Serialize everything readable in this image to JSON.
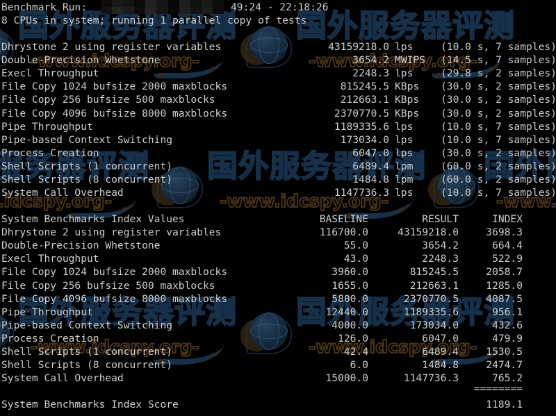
{
  "terminal": {
    "header_line1_label": "Benchmark Run:",
    "header_line1_redacted": "[redacted]",
    "header_line1_time": "49:24 - 22:18:26",
    "header_line2": "8 CPUs in system; running 1 parallel copy of tests",
    "background_color": "#000000",
    "text_color": "#cfcfcf"
  },
  "watermark": {
    "cjk_text": "国外服务器评测",
    "url_text": "-www.idcspy.org-",
    "cjk_color": "#16304a",
    "url_color": "#4a3415"
  },
  "run_results": {
    "rows": [
      {
        "name": "Dhrystone 2 using register variables",
        "value": "43159218.0",
        "unit": "lps",
        "timing": "(10.0 s, 7 samples)"
      },
      {
        "name": "Double-Precision Whetstone",
        "value": "3654.2",
        "unit": "MWIPS",
        "timing": "(14.5 s, 7 samples)"
      },
      {
        "name": "Execl Throughput",
        "value": "2248.3",
        "unit": "lps",
        "timing": "(29.8 s, 2 samples)"
      },
      {
        "name": "File Copy 1024 bufsize 2000 maxblocks",
        "value": "815245.5",
        "unit": "KBps",
        "timing": "(30.0 s, 2 samples)"
      },
      {
        "name": "File Copy 256 bufsize 500 maxblocks",
        "value": "212663.1",
        "unit": "KBps",
        "timing": "(30.0 s, 2 samples)"
      },
      {
        "name": "File Copy 4096 bufsize 8000 maxblocks",
        "value": "2370770.5",
        "unit": "KBps",
        "timing": "(30.0 s, 2 samples)"
      },
      {
        "name": "Pipe Throughput",
        "value": "1189335.6",
        "unit": "lps",
        "timing": "(10.0 s, 7 samples)"
      },
      {
        "name": "Pipe-based Context Switching",
        "value": "173034.0",
        "unit": "lps",
        "timing": "(10.0 s, 7 samples)"
      },
      {
        "name": "Process Creation",
        "value": "6047.0",
        "unit": "lps",
        "timing": "(30.0 s, 2 samples)"
      },
      {
        "name": "Shell Scripts (1 concurrent)",
        "value": "6489.4",
        "unit": "lpm",
        "timing": "(60.0 s, 2 samples)"
      },
      {
        "name": "Shell Scripts (8 concurrent)",
        "value": "1484.8",
        "unit": "lpm",
        "timing": "(60.0 s, 2 samples)"
      },
      {
        "name": "System Call Overhead",
        "value": "1147736.3",
        "unit": "lps",
        "timing": "(10.0 s, 7 samples)"
      }
    ]
  },
  "index_table": {
    "title": "System Benchmarks Index Values",
    "header_baseline": "BASELINE",
    "header_result": "RESULT",
    "header_index": "INDEX",
    "rows": [
      {
        "name": "Dhrystone 2 using register variables",
        "baseline": "116700.0",
        "result": "43159218.0",
        "index": "3698.3"
      },
      {
        "name": "Double-Precision Whetstone",
        "baseline": "55.0",
        "result": "3654.2",
        "index": "664.4"
      },
      {
        "name": "Execl Throughput",
        "baseline": "43.0",
        "result": "2248.3",
        "index": "522.9"
      },
      {
        "name": "File Copy 1024 bufsize 2000 maxblocks",
        "baseline": "3960.0",
        "result": "815245.5",
        "index": "2058.7"
      },
      {
        "name": "File Copy 256 bufsize 500 maxblocks",
        "baseline": "1655.0",
        "result": "212663.1",
        "index": "1285.0"
      },
      {
        "name": "File Copy 4096 bufsize 8000 maxblocks",
        "baseline": "5800.0",
        "result": "2370770.5",
        "index": "4087.5"
      },
      {
        "name": "Pipe Throughput",
        "baseline": "12440.0",
        "result": "1189335.6",
        "index": "956.1"
      },
      {
        "name": "Pipe-based Context Switching",
        "baseline": "4000.0",
        "result": "173034.0",
        "index": "432.6"
      },
      {
        "name": "Process Creation",
        "baseline": "126.0",
        "result": "6047.0",
        "index": "479.9"
      },
      {
        "name": "Shell Scripts (1 concurrent)",
        "baseline": "42.4",
        "result": "6489.4",
        "index": "1530.5"
      },
      {
        "name": "Shell Scripts (8 concurrent)",
        "baseline": "6.0",
        "result": "1484.8",
        "index": "2474.7"
      },
      {
        "name": "System Call Overhead",
        "baseline": "15000.0",
        "result": "1147736.3",
        "index": "765.2"
      }
    ],
    "separator": "========",
    "score_label": "System Benchmarks Index Score",
    "score_value": "1189.1"
  }
}
